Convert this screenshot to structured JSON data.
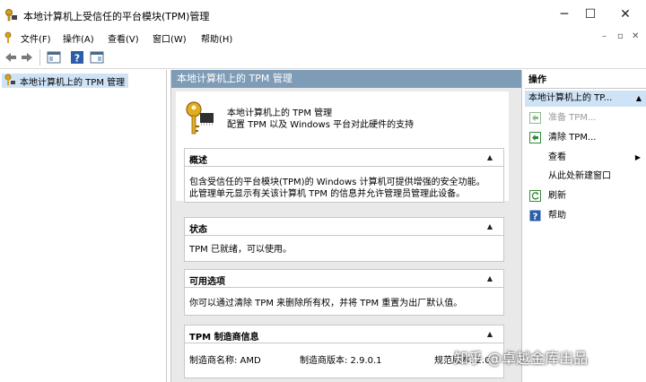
{
  "window": {
    "title": "本地计算机上受信任的平台模块(TPM)管理",
    "controls": {
      "minimize": "─",
      "maximize": "☐",
      "close": "✕"
    }
  },
  "menu": {
    "items": [
      "文件(F)",
      "操作(A)",
      "查看(V)",
      "窗口(W)",
      "帮助(H)"
    ],
    "doc_controls": [
      "–",
      "▫",
      "✕"
    ]
  },
  "toolbar": {
    "icons": [
      "back-arrow-icon",
      "forward-arrow-icon",
      "show-hide-tree-icon",
      "help-icon",
      "properties-icon"
    ]
  },
  "tree": {
    "root_label": "本地计算机上的 TPM 管理"
  },
  "center": {
    "header": "本地计算机上的 TPM 管理",
    "intro_title": "本地计算机上的 TPM 管理",
    "intro_desc": "配置 TPM 以及 Windows 平台对此硬件的支持",
    "sections": [
      {
        "title": "概述",
        "lines": [
          "包含受信任的平台模块(TPM)的 Windows 计算机可提供增强的安全功能。",
          "此管理单元显示有关该计算机 TPM 的信息并允许管理员管理此设备。"
        ]
      },
      {
        "title": "状态",
        "lines": [
          "TPM 已就绪，可以使用。"
        ]
      },
      {
        "title": "可用选项",
        "lines": [
          "你可以通过清除 TPM 来删除所有权，并将 TPM 重置为出厂默认值。"
        ]
      },
      {
        "title": "TPM 制造商信息",
        "manufacturer_name": "制造商名称: AMD",
        "manufacturer_version": "制造商版本: 2.9.0.1",
        "spec_version": "规范版本: 2.0"
      }
    ],
    "toggle": "▲"
  },
  "actions": {
    "header": "操作",
    "subheader": "本地计算机上的 TP...",
    "items": [
      {
        "label": "准备 TPM...",
        "icon": "prepare-tpm-icon",
        "disabled": true
      },
      {
        "label": "清除 TPM...",
        "icon": "clear-tpm-icon",
        "disabled": false
      },
      {
        "label": "查看",
        "icon": "",
        "submenu": "▶"
      },
      {
        "label": "从此处新建窗口",
        "icon": ""
      },
      {
        "label": "刷新",
        "icon": "refresh-icon"
      },
      {
        "label": "帮助",
        "icon": "help-icon"
      }
    ]
  },
  "watermark": "知乎 @卓越金库出品",
  "colors": {
    "center_header_bg": "#7f9cb6",
    "selection_bg": "#cfe3f7",
    "panel_bg": "#e9e9e9"
  }
}
